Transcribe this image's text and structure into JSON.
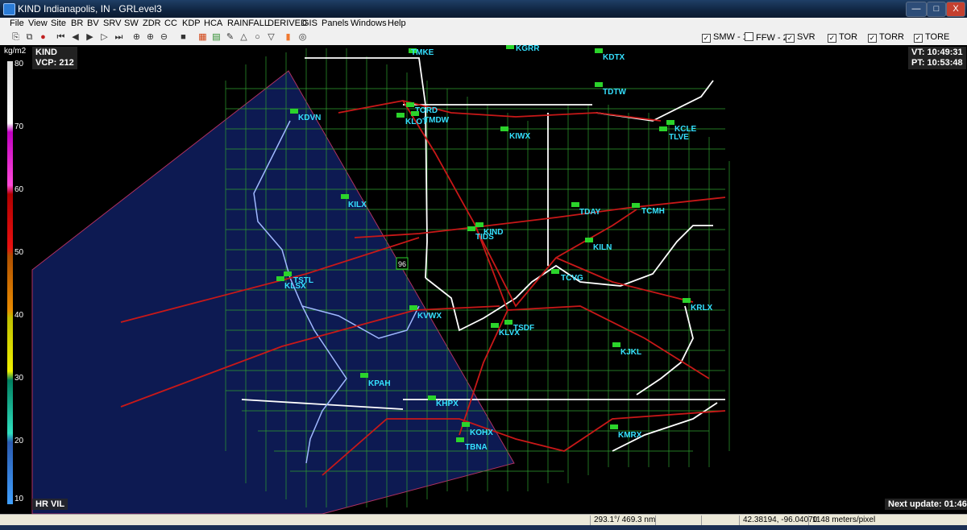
{
  "window": {
    "title": "KIND Indianapolis, IN - GRLevel3",
    "minimize": "—",
    "maximize": "□",
    "close": "X"
  },
  "menu": [
    "File",
    "View",
    "Site",
    "BR",
    "BV",
    "SRV",
    "SW",
    "ZDR",
    "CC",
    "KDP",
    "HCA",
    "RAINFALL",
    "DERIVED",
    "GIS",
    "Panels",
    "Windows",
    "Help"
  ],
  "toolbar": {
    "checkboxes": [
      {
        "label": "SMW - 1",
        "checked": true
      },
      {
        "label": "FFW - 2",
        "checked": false
      },
      {
        "label": "SVR",
        "checked": true
      },
      {
        "label": "TOR",
        "checked": true
      },
      {
        "label": "TORR",
        "checked": true
      },
      {
        "label": "TORE",
        "checked": true
      }
    ]
  },
  "colorbar": {
    "unit": "kg/m2",
    "ticks": [
      "80",
      "70",
      "60",
      "50",
      "40",
      "30",
      "20",
      "10"
    ]
  },
  "radar": {
    "site": "KIND",
    "vcp": "VCP: 212",
    "vt": "VT: 10:49:31",
    "pt": "PT: 10:53:48",
    "product": "HR VIL",
    "next_update": "Next update: 01:46",
    "route_shield": "96"
  },
  "sites": [
    "TMKE",
    "KGRR",
    "KDTX",
    "TDTW",
    "TORD",
    "KLOT",
    "TMDW",
    "KDVN",
    "KIWX",
    "KCLE",
    "TLVE",
    "KILX",
    "TDAY",
    "TCMH",
    "KIND",
    "TIDS",
    "KILN",
    "TSTL",
    "KLSX",
    "TCVG",
    "KRLX",
    "KVWX",
    "TSDF",
    "KLVX",
    "KJKL",
    "KPAH",
    "KHPX",
    "KOHX",
    "TBNA",
    "KMRX"
  ],
  "status": {
    "azimuth_range": "293.1°/ 469.3 nm",
    "coords": "42.38194, -96.04070",
    "resolution": "1148 meters/pixel"
  }
}
